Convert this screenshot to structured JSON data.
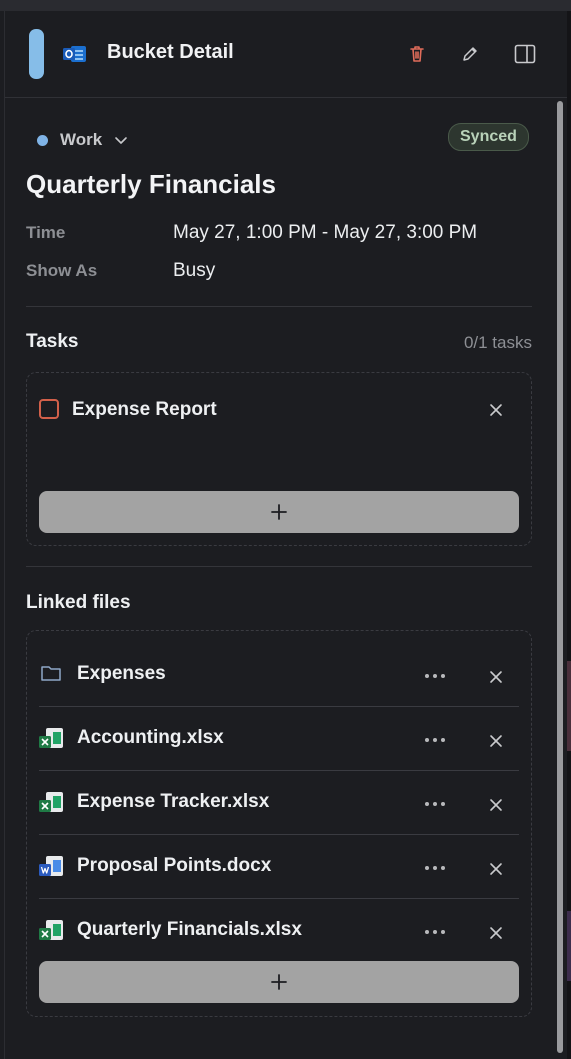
{
  "header": {
    "title": "Bucket Detail",
    "delete_icon": "trash-icon",
    "edit_icon": "pencil-icon",
    "panel_icon": "side-panel-icon",
    "app_icon": "outlook-icon"
  },
  "event": {
    "calendar": "Work",
    "calendar_color": "#7fb3e6",
    "status_badge": "Synced",
    "title": "Quarterly Financials",
    "time_label": "Time",
    "time_value": "May 27, 1:00 PM - May 27, 3:00 PM",
    "show_as_label": "Show As",
    "show_as_value": "Busy"
  },
  "tasks": {
    "heading": "Tasks",
    "count": "0/1 tasks",
    "items": [
      {
        "label": "Expense Report",
        "checked": false
      }
    ],
    "add_label": "+"
  },
  "linked_files": {
    "heading": "Linked files",
    "items": [
      {
        "name": "Expenses",
        "type": "folder"
      },
      {
        "name": "Accounting.xlsx",
        "type": "excel"
      },
      {
        "name": "Expense Tracker.xlsx",
        "type": "excel"
      },
      {
        "name": "Proposal Points.docx",
        "type": "word"
      },
      {
        "name": "Quarterly Financials.xlsx",
        "type": "excel"
      }
    ],
    "add_label": "+"
  },
  "colors": {
    "accent": "#86bde8",
    "delete": "#e06c5a",
    "checkbox": "#d2604a",
    "excel": "#1f7a45",
    "word": "#2b5bbf"
  }
}
